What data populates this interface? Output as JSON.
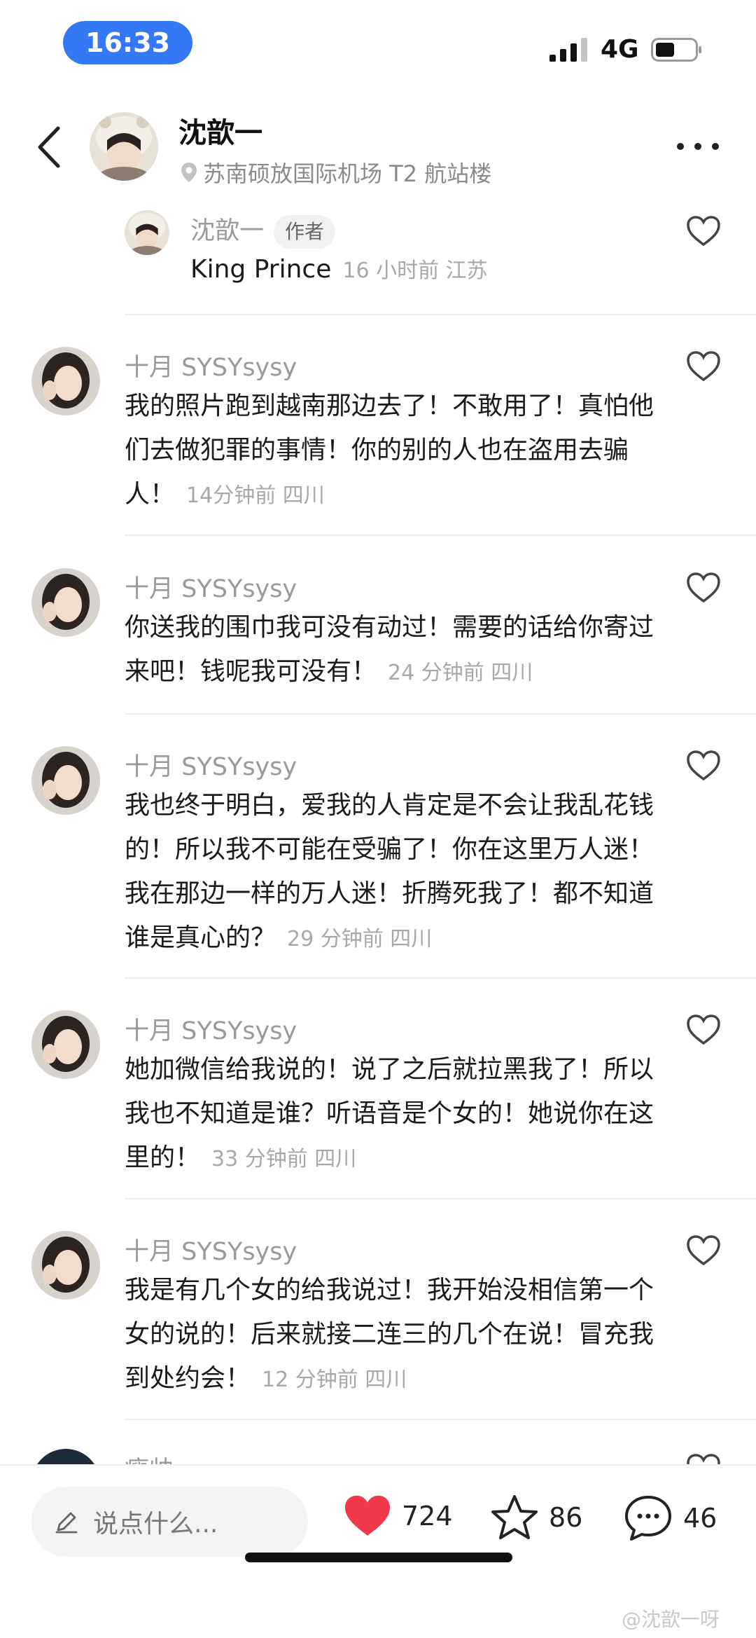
{
  "status_bar": {
    "time": "16:33",
    "network": "4G"
  },
  "header": {
    "name": "沈歆一",
    "location": "苏南硕放国际机场 T2 航站楼"
  },
  "reply": {
    "name": "沈歆一",
    "badge": "作者",
    "text": "King Prince",
    "meta": "16 小时前 江苏"
  },
  "comments": [
    {
      "name": "十月 SYSYsysy",
      "text": "我的照片跑到越南那边去了！不敢用了！真怕他们去做犯罪的事情！你的别的人也在盗用去骗人！",
      "meta": "14分钟前 四川"
    },
    {
      "name": "十月 SYSYsysy",
      "text": "你送我的围巾我可没有动过！需要的话给你寄过来吧！钱呢我可没有！",
      "meta": "24 分钟前 四川"
    },
    {
      "name": "十月 SYSYsysy",
      "text": "我也终于明白，爱我的人肯定是不会让我乱花钱的！所以我不可能在受骗了！你在这里万人迷！我在那边一样的万人迷！折腾死我了！都不知道谁是真心的？",
      "meta": "29 分钟前 四川"
    },
    {
      "name": "十月 SYSYsysy",
      "text": "她加微信给我说的！说了之后就拉黑我了！所以我也不知道是谁？听语音是个女的！她说你在这里的！",
      "meta": "33 分钟前 四川"
    },
    {
      "name": "十月 SYSYsysy",
      "text": "我是有几个女的给我说过！我开始没相信第一个女的说的！后来就接二连三的几个在说！冒充我到处约会！",
      "meta": "12 分钟前 四川"
    },
    {
      "name": "瘦帅",
      "text": "",
      "meta": ""
    }
  ],
  "bottom_bar": {
    "input_placeholder": "说点什么...",
    "likes": "724",
    "favorites": "86",
    "comments": "46"
  },
  "watermark": "@沈歆一呀",
  "colors": {
    "accent": "#3478f6",
    "like_red": "#f2394b",
    "muted": "#9a9a9a"
  }
}
